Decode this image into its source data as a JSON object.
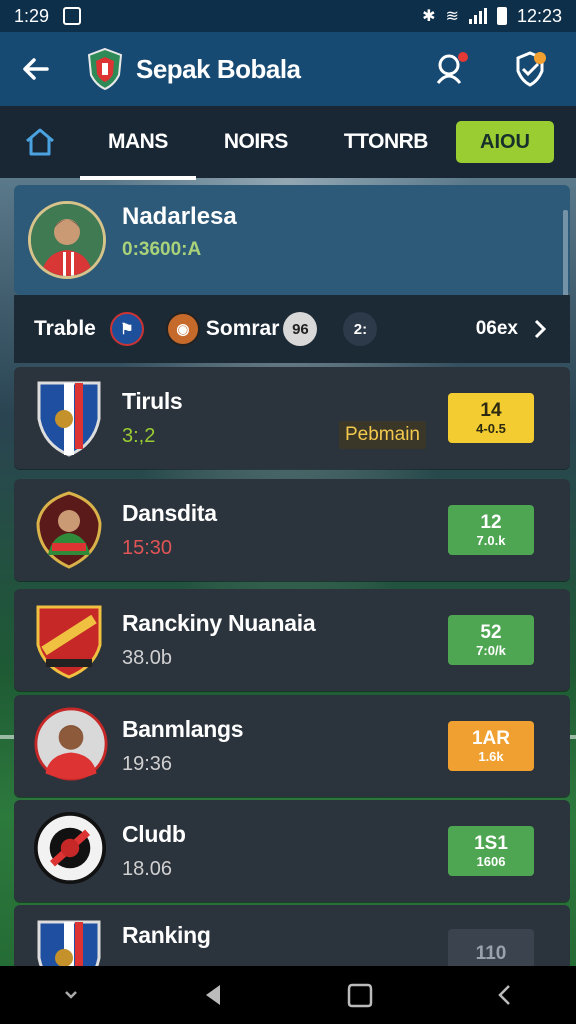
{
  "status_bar": {
    "time_left": "1:29",
    "time_right": "12:23"
  },
  "app_bar": {
    "title": "Sepak Bobala"
  },
  "tabs": {
    "items": [
      {
        "label": "MANS",
        "active": true
      },
      {
        "label": "NOIRS",
        "active": false
      },
      {
        "label": "TTONRB",
        "active": false
      }
    ],
    "action_label": "AIOU"
  },
  "profile": {
    "name": "Nadarlesa",
    "subtitle": "0:3600:A"
  },
  "filter_bar": {
    "label": "Trable",
    "item_label": "Somrar",
    "badge_a": "96",
    "badge_b": "2:",
    "more_label": "06ex"
  },
  "rows": [
    {
      "title": "Tiruls",
      "meta": "3:,2",
      "meta_color": "#9acd32",
      "tag": "Pebmain",
      "score_big": "14",
      "score_small": "4-0.5",
      "score_bg": "#f2cc30",
      "score_fg": "#2c2a10",
      "crest": "shield-blue"
    },
    {
      "title": "Dansdita",
      "meta": "15:30",
      "meta_color": "#e05555",
      "score_big": "12",
      "score_small": "7.0.k",
      "score_bg": "#4fa652",
      "score_fg": "#ffffff",
      "crest": "crest-red"
    },
    {
      "title": "Ranckiny Nuanaia",
      "meta": "38.0b",
      "meta_color": "#d0d0d0",
      "score_big": "52",
      "score_small": "7:0/k",
      "score_bg": "#4fa652",
      "score_fg": "#ffffff",
      "crest": "shield-red"
    },
    {
      "title": "Banmlangs",
      "meta": "19:36",
      "meta_color": "#d0d0d0",
      "score_big": "1AR",
      "score_small": "1.6k",
      "score_bg": "#f0a030",
      "score_fg": "#ffffff",
      "crest": "player"
    },
    {
      "title": "Cludb",
      "meta": "18.06",
      "meta_color": "#d0d0d0",
      "score_big": "1S1",
      "score_small": "1606",
      "score_bg": "#4fa652",
      "score_fg": "#ffffff",
      "crest": "round-black"
    },
    {
      "title": "Ranking",
      "meta": "",
      "meta_color": "#d0d0d0",
      "score_big": "110",
      "score_small": "",
      "score_bg": "#3b444e",
      "score_fg": "#9aa3ad",
      "crest": "shield-blue"
    }
  ],
  "icons": {
    "back": "arrow-left-icon",
    "search_person": "search-person-icon",
    "badge_check": "badge-check-icon",
    "home": "home-icon",
    "chevron": "chevron-right-icon"
  }
}
